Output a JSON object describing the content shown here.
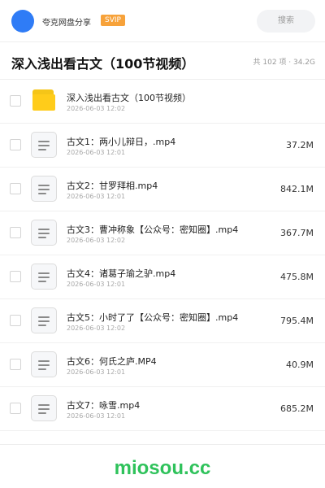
{
  "header": {
    "share_name": "夸克网盘分享",
    "vip_badge": "SVIP",
    "search_label": "搜索"
  },
  "title_bar": {
    "title": "深入浅出看古文（100节视频）",
    "summary": "共 102 项 · 34.2G"
  },
  "files": [
    {
      "name": "深入浅出看古文（100节视频）",
      "date": "2026-06-03 12:02",
      "size": "",
      "icon": "folder-icon"
    },
    {
      "name": "古文1：两小儿辩日，.mp4",
      "date": "2026-06-03 12:01",
      "size": "37.2M",
      "icon": "document-icon"
    },
    {
      "name": "古文2：甘罗拜相.mp4",
      "date": "2026-06-03 12:01",
      "size": "842.1M",
      "icon": "document-icon"
    },
    {
      "name": "古文3：曹冲称象【公众号：密知圈】.mp4",
      "date": "2026-06-03 12:02",
      "size": "367.7M",
      "icon": "document-icon"
    },
    {
      "name": "古文4：诸葛子瑜之驴.mp4",
      "date": "2026-06-03 12:01",
      "size": "475.8M",
      "icon": "document-icon"
    },
    {
      "name": "古文5：小时了了【公众号：密知圈】.mp4",
      "date": "2026-06-03 12:02",
      "size": "795.4M",
      "icon": "document-icon"
    },
    {
      "name": "古文6：何氏之庐.MP4",
      "date": "2026-06-03 12:01",
      "size": "40.9M",
      "icon": "document-icon"
    },
    {
      "name": "古文7：咏雪.mp4",
      "date": "2026-06-03 12:01",
      "size": "685.2M",
      "icon": "document-icon"
    }
  ],
  "watermark": "miosou.cc",
  "colors": {
    "accent": "#2f7cf6",
    "vip": "#f7a23a",
    "folder": "#ffcc1a",
    "watermark": "#2fc25b"
  }
}
